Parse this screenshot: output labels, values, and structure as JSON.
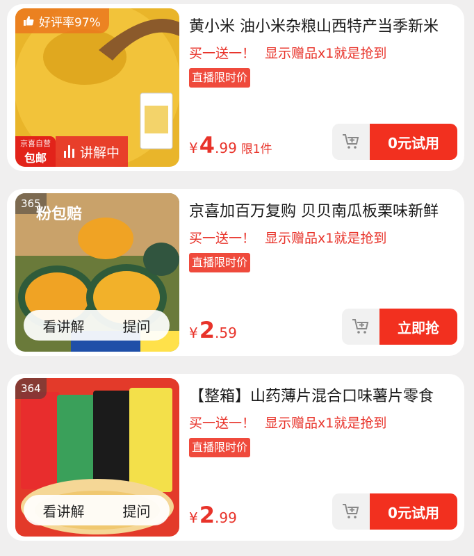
{
  "products": [
    {
      "rating_badge": "好评率97%",
      "store_tag_top": "京喜自营",
      "store_tag_bottom": "包邮",
      "live_label": "讲解中",
      "title": "黄小米 油小米杂粮山西特产当季新米",
      "gift_text": "买一送一！",
      "gift_detail": "显示赠品x1就是抢到",
      "live_price_tag": "直播限时价",
      "price_currency": "¥",
      "price_int": "4",
      "price_dec": ".99",
      "limit_text": "限1件",
      "action_label": "0元试用"
    },
    {
      "rank": "365",
      "banner_text": "粉包赔",
      "title": "京喜加百万复购 贝贝南瓜板栗味新鲜",
      "gift_text": "买一送一！",
      "gift_detail": "显示赠品x1就是抢到",
      "live_price_tag": "直播限时价",
      "explain_label": "看讲解",
      "ask_label": "提问",
      "price_currency": "¥",
      "price_int": "2",
      "price_dec": ".59",
      "action_label": "立即抢"
    },
    {
      "rank": "364",
      "title": "【整箱】山药薄片混合口味薯片零食",
      "gift_text": "买一送一！",
      "gift_detail": "显示赠品x1就是抢到",
      "live_price_tag": "直播限时价",
      "explain_label": "看讲解",
      "ask_label": "提问",
      "price_currency": "¥",
      "price_int": "2",
      "price_dec": ".99",
      "action_label": "0元试用"
    }
  ],
  "colors": {
    "accent_red": "#f2301f",
    "price_red": "#e8332a",
    "background": "#f0efef"
  },
  "icons": {
    "thumbs_up": "thumbs-up-icon",
    "cart": "add-to-cart-icon",
    "live_bars": "live-bars-icon"
  }
}
